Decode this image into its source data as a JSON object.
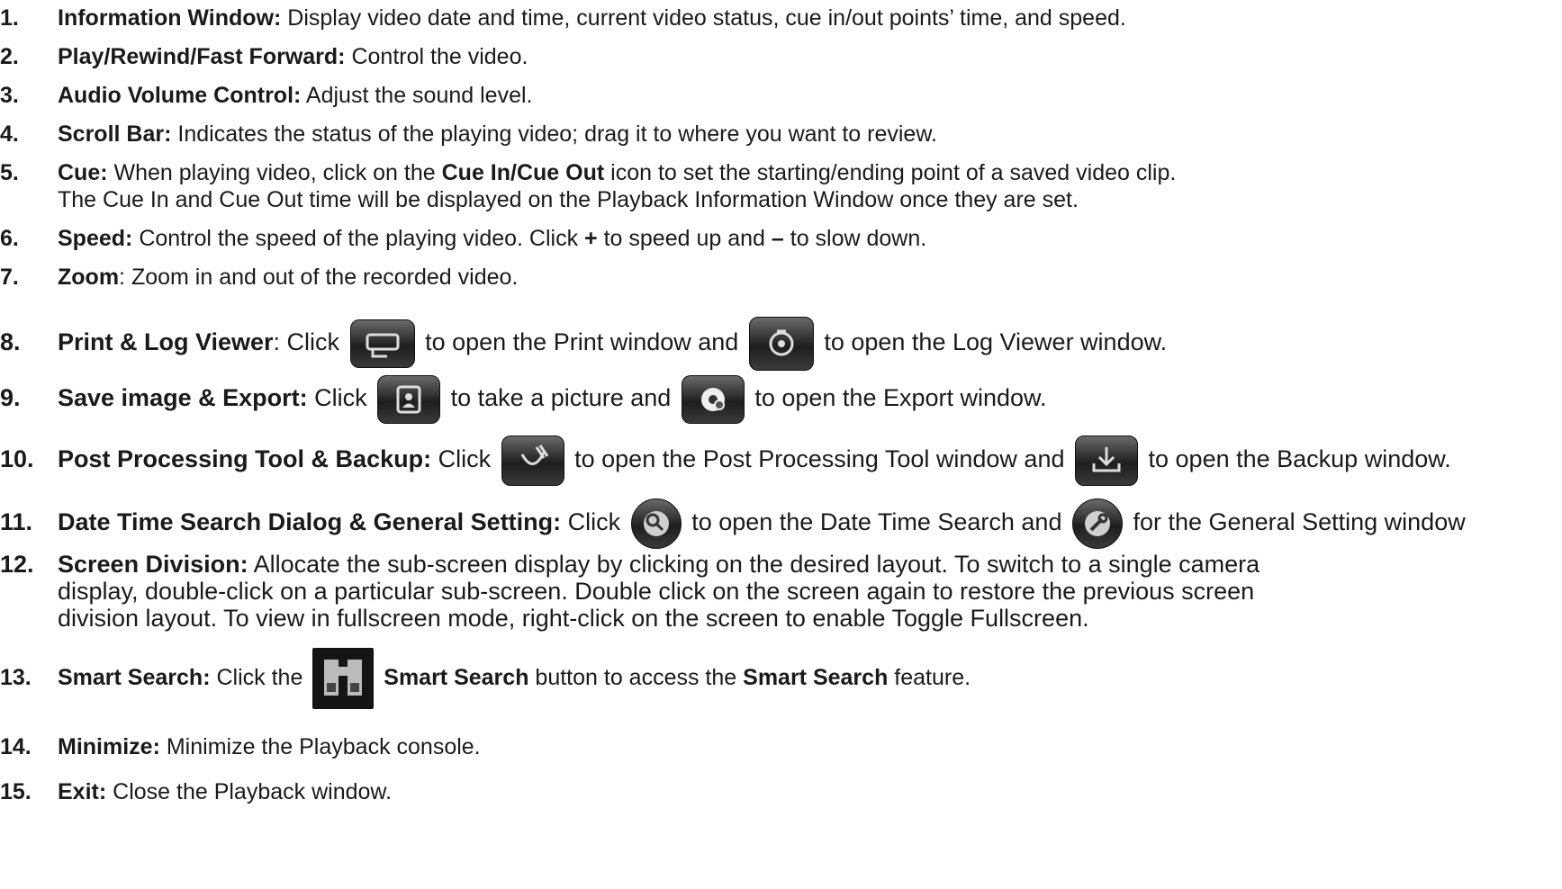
{
  "items": [
    {
      "num": "1.",
      "title": "Information Window:",
      "text": "Display video date and time, current video status, cue in/out points’ time, and speed."
    },
    {
      "num": "2.",
      "title": "Play/Rewind/Fast Forward:",
      "text": "Control the video."
    },
    {
      "num": "3.",
      "title": "Audio Volume Control:",
      "text": "Adjust the sound level."
    },
    {
      "num": "4.",
      "title": "Scroll Bar:",
      "text": "Indicates the status of the playing video; drag it to where you want to review."
    },
    {
      "num": "5.",
      "title": "Cue:",
      "text_a": "When playing video, click on the",
      "bold_a": "Cue In/Cue Out",
      "text_b": "icon to set the starting/ending point of a saved video clip.",
      "line2": "The Cue In and Cue Out time will be displayed on the Playback Information Window once they are set."
    },
    {
      "num": "6.",
      "title": "Speed:",
      "text_a": "Control the speed of the playing video. Click",
      "plus": "+",
      "text_b": "to speed up and",
      "minus": "–",
      "text_c": "to slow down."
    },
    {
      "num": "7.",
      "title": "Zoom",
      "text": ": Zoom in and out of the recorded video."
    },
    {
      "num": "8.",
      "title": "Print & Log Viewer",
      "text_a": ": Click",
      "text_b": "to open the Print window and",
      "text_c": "to open the Log Viewer window."
    },
    {
      "num": "9.",
      "title": "Save image & Export:",
      "text_a": "Click",
      "text_b": "to take a picture and",
      "text_c": "to open the Export window."
    },
    {
      "num": "10.",
      "title": "Post Processing Tool & Backup:",
      "text_a": "Click",
      "text_b": "to open the Post Processing Tool window and",
      "text_c": "to open the Backup window."
    },
    {
      "num": "11.",
      "title": "Date Time Search Dialog & General Setting:",
      "text_a": "Click",
      "text_b": "to open the Date Time Search and",
      "text_c": "for the General Setting window"
    },
    {
      "num": "12.",
      "title": "Screen Division:",
      "text": "Allocate the sub-screen display by clicking on the desired layout. To switch to a single camera",
      "line2": "display, double-click on a particular sub-screen. Double click on the screen again to restore the previous screen",
      "line3": "division layout. To view in fullscreen mode, right-click on the screen to enable Toggle Fullscreen."
    },
    {
      "num": "13.",
      "title": "Smart Search:",
      "text_a": "Click the",
      "bold_a": "Smart Search",
      "text_b": "button to access the",
      "bold_b": "Smart Search",
      "text_c": "feature."
    },
    {
      "num": "14.",
      "title": "Minimize:",
      "text": "Minimize the Playback console."
    },
    {
      "num": "15.",
      "title": "Exit:",
      "text": "Close the Playback window."
    }
  ],
  "icons": {
    "print": "printer-icon",
    "log": "log-viewer-icon",
    "save_image": "save-image-icon",
    "export": "export-icon",
    "post_processing": "post-processing-icon",
    "backup": "backup-icon",
    "date_time_search": "date-time-search-icon",
    "general_setting": "general-setting-icon",
    "smart_search": "binoculars-icon"
  }
}
